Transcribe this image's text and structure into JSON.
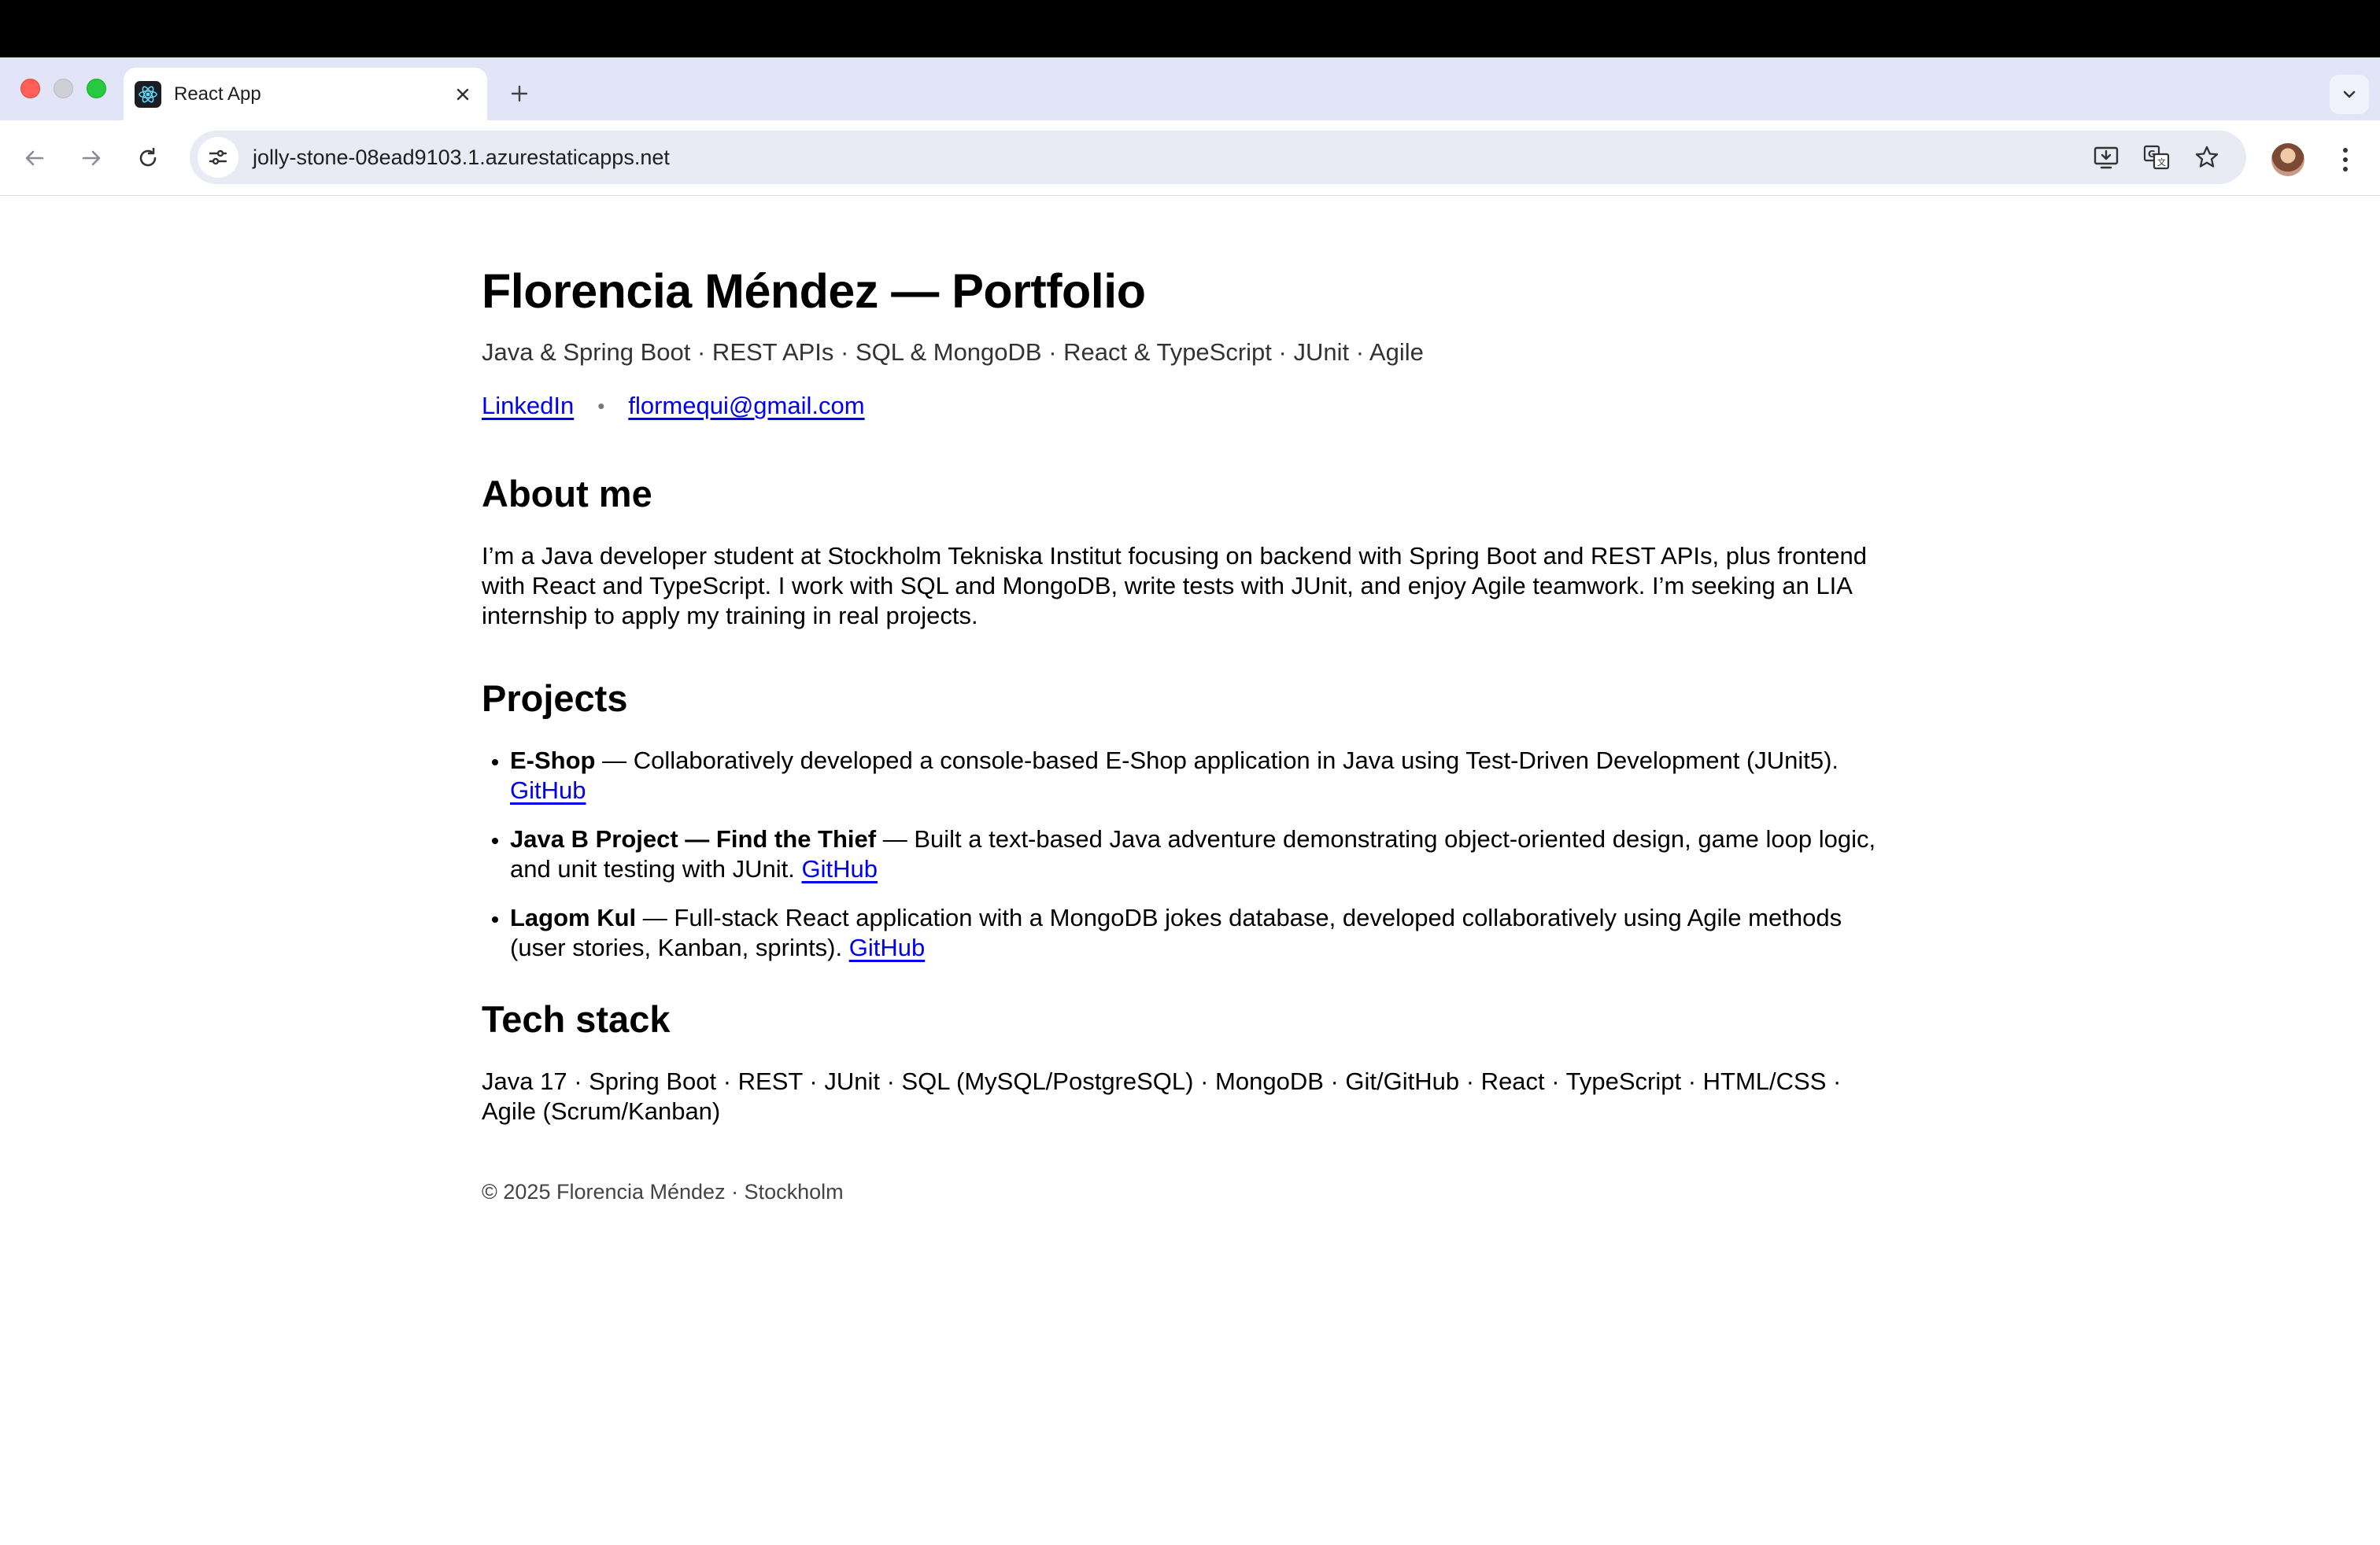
{
  "browser": {
    "tab_title": "React App",
    "url": "jolly-stone-08ead9103.1.azurestaticapps.net"
  },
  "header": {
    "title": "Florencia Méndez — Portfolio",
    "tagline": "Java & Spring Boot · REST APIs · SQL & MongoDB · React & TypeScript · JUnit · Agile",
    "links": {
      "linkedin": "LinkedIn",
      "separator": "•",
      "email": "flormequi@gmail.com"
    }
  },
  "about": {
    "heading": "About me",
    "text": "I’m a Java developer student at Stockholm Tekniska Institut focusing on backend with Spring Boot and REST APIs, plus frontend with React and TypeScript. I work with SQL and MongoDB, write tests with JUnit, and enjoy Agile teamwork. I’m seeking an LIA internship to apply my training in real projects."
  },
  "projects": {
    "heading": "Projects",
    "items": [
      {
        "name": "E-Shop",
        "description": " — Collaboratively developed a console-based E-Shop application in Java using Test-Driven Development (JUnit5). ",
        "link": "GitHub"
      },
      {
        "name": "Java B Project — Find the Thief",
        "description": " — Built a text-based Java adventure demonstrating object-oriented design, game loop logic, and unit testing with JUnit. ",
        "link": "GitHub"
      },
      {
        "name": "Lagom Kul",
        "description": " — Full-stack React application with a MongoDB jokes database, developed collaboratively using Agile methods (user stories, Kanban, sprints). ",
        "link": "GitHub"
      }
    ]
  },
  "tech": {
    "heading": "Tech stack",
    "text": "Java 17 · Spring Boot · REST · JUnit · SQL (MySQL/PostgreSQL) · MongoDB · Git/GitHub · React · TypeScript · HTML/CSS · Agile (Scrum/Kanban)"
  },
  "footer": {
    "text": "© 2025 Florencia Méndez · Stockholm"
  },
  "colors": {
    "link": "#0000ee",
    "chrome": "#e2e5f8",
    "topbar": "#000000"
  },
  "icons": [
    "react-favicon-icon",
    "close-icon",
    "plus-icon",
    "chevron-down-icon",
    "back-arrow-icon",
    "forward-arrow-icon",
    "reload-icon",
    "site-settings-icon",
    "install-app-icon",
    "translate-icon",
    "star-icon",
    "kebab-menu-icon"
  ]
}
